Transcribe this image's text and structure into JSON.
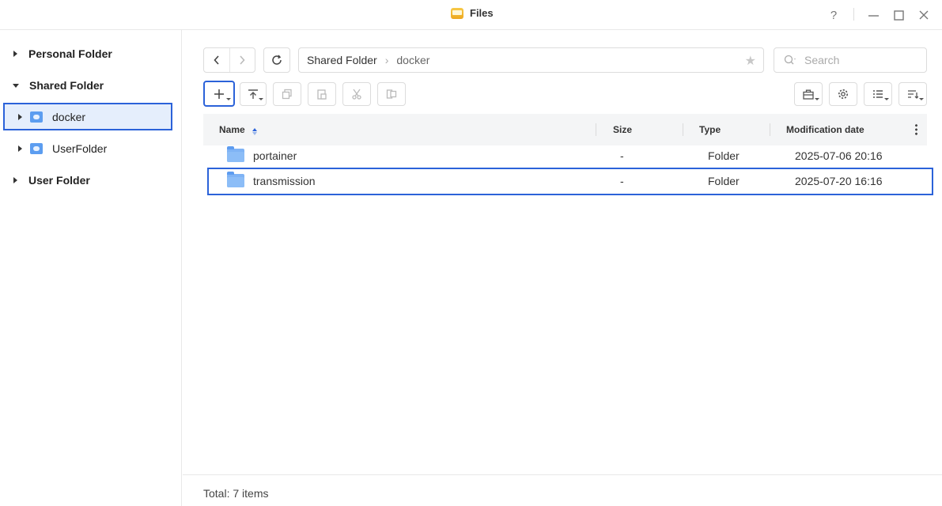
{
  "window": {
    "title": "Files",
    "help": "?"
  },
  "sidebar": {
    "items": [
      {
        "label": "Personal Folder"
      },
      {
        "label": "Shared Folder"
      },
      {
        "label": "docker"
      },
      {
        "label": "UserFolder"
      },
      {
        "label": "User Folder"
      }
    ]
  },
  "toolbar": {
    "path": {
      "root": "Shared Folder",
      "current": "docker"
    },
    "search_placeholder": "Search"
  },
  "table": {
    "columns": {
      "name": "Name",
      "size": "Size",
      "type": "Type",
      "modified": "Modification date"
    },
    "rows": [
      {
        "name": "portainer",
        "size": "-",
        "type": "Folder",
        "modified": "2025-07-06 20:16"
      },
      {
        "name": "transmission",
        "size": "-",
        "type": "Folder",
        "modified": "2025-07-20 16:16"
      }
    ]
  },
  "footer": {
    "total": "Total: 7 items"
  },
  "colors": {
    "accent": "#2b62d9",
    "selection_bg": "#e5eefc",
    "folder": "#7fb3f5"
  }
}
